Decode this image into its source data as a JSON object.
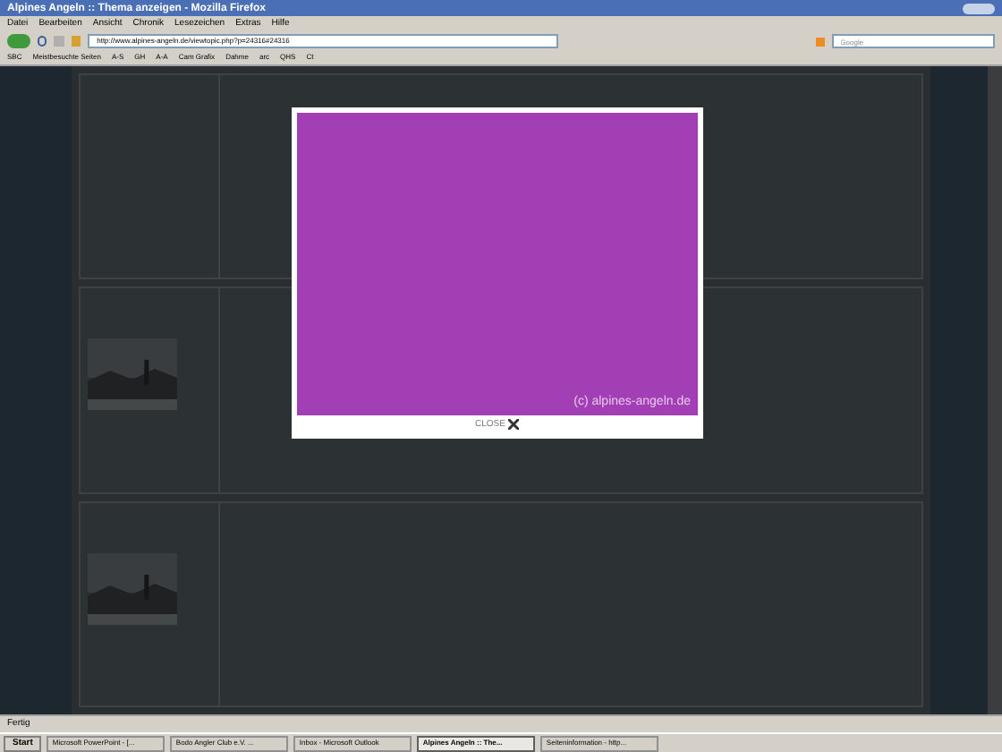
{
  "window": {
    "title": "Alpines Angeln :: Thema anzeigen - Mozilla Firefox"
  },
  "menu": [
    "Datei",
    "Bearbeiten",
    "Ansicht",
    "Chronik",
    "Lesezeichen",
    "Extras",
    "Hilfe"
  ],
  "address_bar": {
    "url": "http://www.alpines-angeln.de/viewtopic.php?p=24316#24316"
  },
  "search": {
    "placeholder": "Google"
  },
  "bookmarks": [
    "SBC",
    "Meistbesuchte Seiten",
    "A-S",
    "GH",
    "A-A",
    "Cam Grafix",
    "Dahme",
    "arc",
    "QHS",
    "Ct"
  ],
  "lightbox": {
    "caption": "(c) alpines-angeln.de",
    "close": "CLOSE"
  },
  "status_bar": {
    "text": "Fertig"
  },
  "taskbar": {
    "start": "Start",
    "items": [
      {
        "label": "Microsoft PowerPoint - [...",
        "selected": false
      },
      {
        "label": "Bodo Angler Club e.V. ...",
        "selected": false
      },
      {
        "label": "Inbox - Microsoft Outlook",
        "selected": false
      },
      {
        "label": "Alpines Angeln :: The...",
        "selected": true
      },
      {
        "label": "Seiteninformation - http...",
        "selected": false
      }
    ]
  }
}
